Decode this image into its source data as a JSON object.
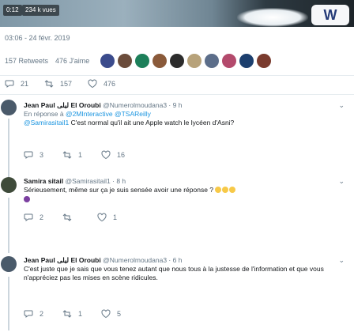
{
  "media": {
    "time_badge": "0:12",
    "views_badge": "234 k vues",
    "logo_text": "W"
  },
  "tweet": {
    "date": "03:06 - 24 févr. 2019",
    "retweets": "157 Retweets",
    "likes": "476 J'aime",
    "actions": {
      "replies": "21",
      "retweets": "157",
      "likes": "476"
    },
    "avatar_colors": [
      "#3b4b8c",
      "#6b4c3b",
      "#1d7f5a",
      "#8a5a3a",
      "#2c2c2c",
      "#b7a27a",
      "#5c6e8a",
      "#b34a6c",
      "#1c3f6e",
      "#7a3b2e"
    ]
  },
  "replies": [
    {
      "name": "Jean Paul ليلى El Oroubi",
      "handle": "@Numerolmoudana3",
      "time": "· 9 h",
      "in_reply_prefix": "En réponse à",
      "in_reply_links": "@2MInteractive @TSAReilly",
      "text_link": "@Samirasitail1",
      "text": " C'est normal qu'il ait une Apple watch le lycéen d'Asni?",
      "actions": {
        "replies": "3",
        "retweets": "1",
        "likes": "16"
      },
      "avatar_color": "#4a5a6a"
    },
    {
      "name": "Samira sitail",
      "handle": "@Samirasitail1",
      "time": "· 8 h",
      "text": "Sérieusement, même sur ça je suis sensée avoir une réponse ?",
      "actions": {
        "replies": "2",
        "retweets": "",
        "likes": "1"
      },
      "avatar_color": "#3f4b3a"
    },
    {
      "name": "Jean Paul ليلى El Oroubi",
      "handle": "@Numerolmoudana3",
      "time": "· 6 h",
      "text": "C'est juste que je sais que vous tenez autant que nous tous à la justesse de l'information et que vous n'appréciez pas les mises en scène ridicules.",
      "actions": {
        "replies": "2",
        "retweets": "1",
        "likes": "5"
      },
      "avatar_color": "#4a5a6a"
    }
  ]
}
